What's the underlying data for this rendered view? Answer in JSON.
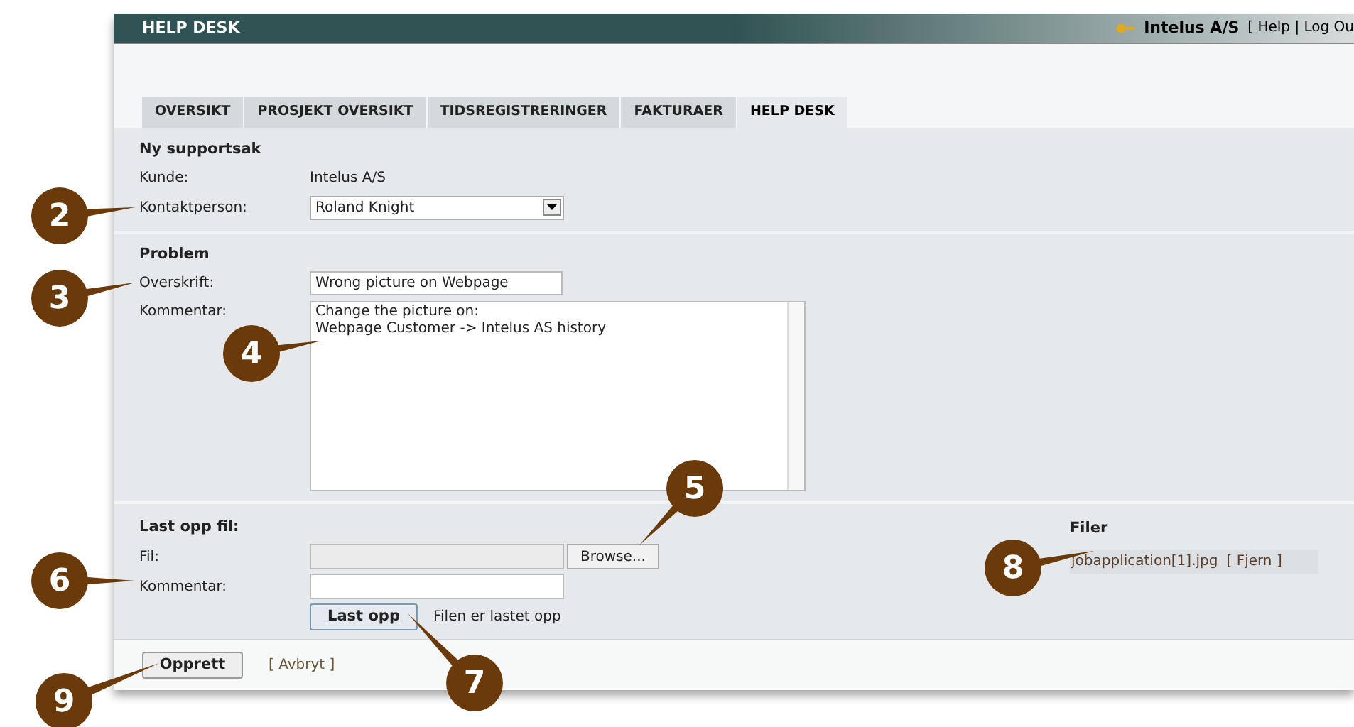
{
  "header": {
    "title": "HELP DESK",
    "company": "Intelus A/S",
    "links": "[ Help | Log Ou"
  },
  "tabs": [
    {
      "label": "OVERSIKT",
      "selected": false
    },
    {
      "label": "PROSJEKT OVERSIKT",
      "selected": false
    },
    {
      "label": "TIDSREGISTRERINGER",
      "selected": false
    },
    {
      "label": "FAKTURAER",
      "selected": false
    },
    {
      "label": "HELP DESK",
      "selected": true
    }
  ],
  "new_case": {
    "heading": "Ny supportsak",
    "customer_label": "Kunde:",
    "customer": "Intelus A/S",
    "contact_label": "Kontaktperson:",
    "contact": "Roland Knight"
  },
  "problem": {
    "heading": "Problem",
    "title_label": "Overskrift:",
    "title": "Wrong picture on Webpage",
    "comment_label": "Kommentar:",
    "comment": "Change the picture on:\nWebpage Customer -> Intelus AS history"
  },
  "upload": {
    "heading": "Last opp fil:",
    "file_label": "Fil:",
    "browse": "Browse...",
    "comment_label": "Kommentar:",
    "upload_button": "Last opp",
    "status": "Filen er lastet opp"
  },
  "files": {
    "heading": "Filer",
    "items": [
      {
        "name": "jobapplication[1].jpg",
        "remove": "[ Fjern ]"
      }
    ]
  },
  "actions": {
    "create": "Opprett",
    "cancel": "[ Avbryt ]"
  },
  "callouts": [
    "2",
    "3",
    "4",
    "5",
    "6",
    "7",
    "8",
    "9"
  ]
}
